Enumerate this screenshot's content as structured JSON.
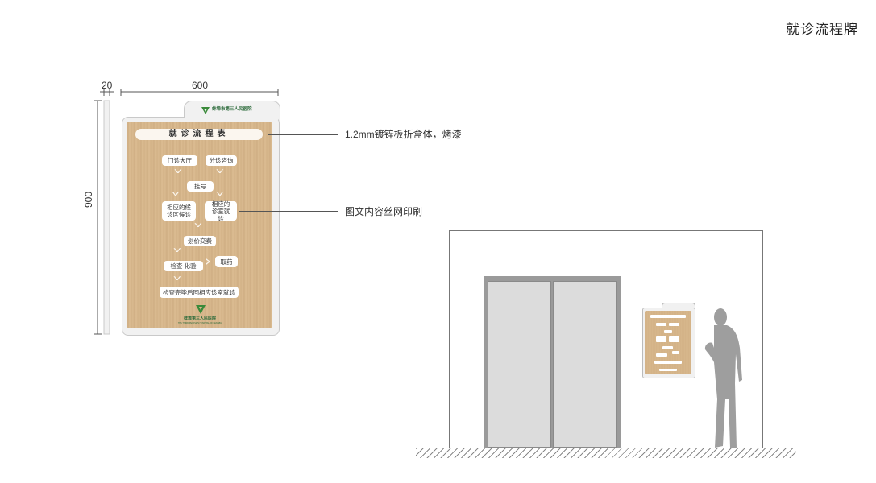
{
  "page": {
    "title": "就诊流程牌"
  },
  "dimensions": {
    "width": "600",
    "depth": "20",
    "height": "900"
  },
  "callouts": {
    "material": "1.2mm镀锌板折盒体，烤漆",
    "print": "图文内容丝网印刷"
  },
  "sign": {
    "hospital_name": "蚌埠市第三人民医院",
    "header": "就诊流程表",
    "steps": {
      "lobby": "门诊大厅",
      "triage": "分诊咨询",
      "register": "挂号",
      "waiting_area": "相应的候诊区候诊",
      "consult_room": "相应的诊室就诊",
      "pay": "划价交费",
      "exam": "检查 化验",
      "pharmacy": "取药",
      "return": "检查完毕后回相应诊室就诊"
    },
    "footer_name": "蚌埠第三人民医院",
    "footer_sub": "THE THIRD PEOPLE'S HOSPITAL OF BENGBU",
    "logo_color": "#3a8a3a"
  },
  "colors": {
    "wood": "#d8b88e",
    "frame": "#f1f1f1",
    "door": "#dcdcdc",
    "figure": "#9e9e9e"
  }
}
